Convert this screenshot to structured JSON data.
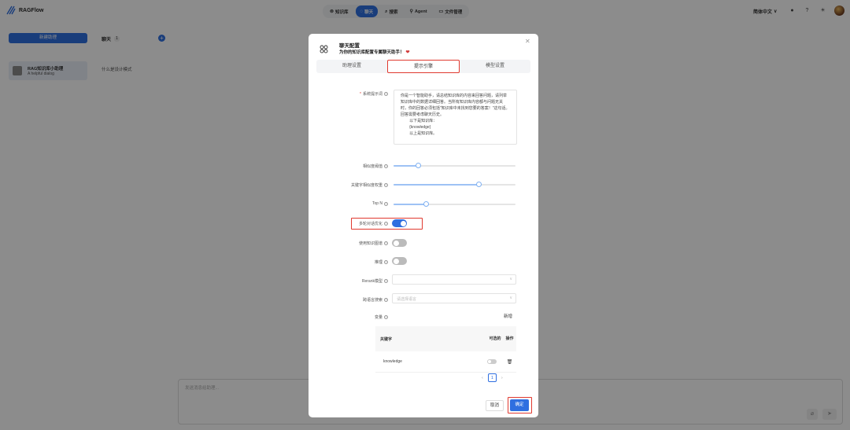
{
  "app": {
    "name": "RAGFlow"
  },
  "nav": [
    {
      "label": "知识库",
      "icon": "database-icon",
      "glyph": "⊜",
      "active": false
    },
    {
      "label": "聊天",
      "icon": "chat-icon",
      "glyph": "◌",
      "active": true
    },
    {
      "label": "搜索",
      "icon": "search-icon",
      "glyph": "⌕",
      "active": false
    },
    {
      "label": "Agent",
      "icon": "agent-icon",
      "glyph": "⚲",
      "active": false
    },
    {
      "label": "文件管理",
      "icon": "folder-icon",
      "glyph": "▭",
      "active": false
    }
  ],
  "header": {
    "language": "简体中文",
    "language_caret": "∨"
  },
  "sidebar": {
    "new_chat_label": "新建助理",
    "chat_section_label": "聊天",
    "chat_count": "1",
    "assistant": {
      "name": "RAG知识库小助理",
      "description": "A helpful dialog"
    }
  },
  "chat_list": {
    "first_item": "什么是设计模式"
  },
  "message_input": {
    "placeholder": "发送消息给助理..."
  },
  "modal": {
    "title": "聊天配置",
    "subtitle": "为你的知识库配置专属聊天助手！",
    "close_glyph": "✕",
    "tabs": [
      {
        "label": "助理设置",
        "active": false
      },
      {
        "label": "提示引擎",
        "active": true
      },
      {
        "label": "模型设置",
        "active": false
      }
    ],
    "fields": {
      "system_prompt": {
        "label": "系统提示词",
        "required": true,
        "value": "你是一个智能助手，请总结知识库的内容来回答问题，请列举知识库中的数据详细回答。当所有知识库内容都与问题无关时，你的回答必须包括\"知识库中未找到您要的答案！\"这句话。回答需要考虑聊天历史。\n        以下是知识库：\n        {knowledge}\n        以上是知识库。"
      },
      "similarity_threshold": {
        "label": "相似度阈值",
        "value": 0.2
      },
      "keyword_weight": {
        "label": "关键字相似度权重",
        "value": 0.7
      },
      "top_n": {
        "label": "Top N",
        "value": 8,
        "max": 30
      },
      "multi_turn_optimization": {
        "label": "多轮对话优化",
        "enabled": true
      },
      "use_knowledge_graph": {
        "label": "使用知识图谱",
        "enabled": false
      },
      "reasoning": {
        "label": "推理",
        "enabled": false
      },
      "rerank_model": {
        "label": "Rerank模型",
        "value": ""
      },
      "cross_language_search": {
        "label": "跨语言搜索",
        "placeholder": "请选择语言"
      },
      "variables": {
        "label": "变量",
        "add_label": "新增",
        "columns": {
          "key": "关键字",
          "optional": "可选的",
          "action": "操作"
        },
        "rows": [
          {
            "key": "knowledge",
            "optional": false
          }
        ],
        "page": "1"
      }
    },
    "cancel_label": "取消",
    "ok_label": "确定"
  },
  "colors": {
    "primary": "#2f6fe0",
    "highlight": "#e0392f"
  }
}
